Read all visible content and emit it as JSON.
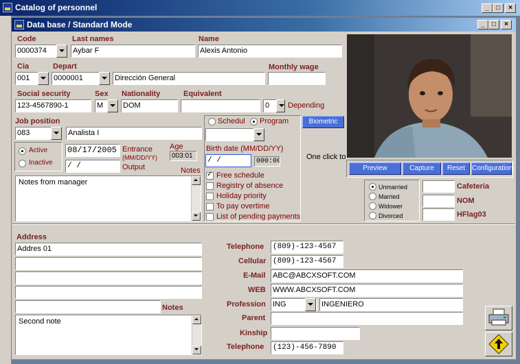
{
  "window": {
    "title": "Catalog of personnel",
    "min": "_",
    "max": "□",
    "close": "×"
  },
  "child": {
    "title": "Data base  /  Standard Mode",
    "min": "_",
    "max": "□",
    "close": "×"
  },
  "labels": {
    "code": "Code",
    "last_names": "Last names",
    "name": "Name",
    "cia": "Cia",
    "depart": "Depart",
    "monthly_wage": "Monthly wage",
    "social_security": "Social  security",
    "sex": "Sex",
    "nationality": "Nationality",
    "equivalent": "Equivalent",
    "depending": "Depending",
    "job_position": "Job position",
    "active": "Active",
    "inactive": "Inactive",
    "entrance": "Entrance",
    "date_format": "(MM/DD/YY)",
    "output": "Output",
    "age": "Age",
    "notes": "Notes",
    "schedul": "Schedul",
    "program": "Program",
    "birth_date": "Birth date (MM/DD/YY)",
    "one_click": "One click to",
    "address": "Address",
    "notes2": "Notes",
    "telephone": "Telephone",
    "cellular": "Cellular",
    "email": "E-Mail",
    "web": "WEB",
    "profession": "Profession",
    "parent": "Parent",
    "kinship": "Kinship",
    "telephone2": "Telephone",
    "cafeteria": "Cafeteria",
    "nom": "NOM",
    "hflag": "HFlag03"
  },
  "values": {
    "code": "0000374",
    "last_names": "Aybar F",
    "name": "Alexis Antonio",
    "cia": "001",
    "depart_code": "0000001",
    "depart_name": "Dirección General",
    "monthly_wage": "",
    "social_security": "123-4567890-1",
    "sex": "M",
    "nationality": "DOM",
    "equivalent": "",
    "depending": "0",
    "job_code": "083",
    "job_name": "Analista I",
    "entrance": "08/17/2005",
    "output": "  /    /",
    "age": "003:01",
    "notes": "Notes from manager",
    "birth_date": " / /",
    "birth_time": "000:00",
    "address1": "Addres 01",
    "address2": "",
    "address3": "",
    "address4": "",
    "address5": "",
    "notes2": "Second note",
    "telephone": "(809)-123-4567",
    "cellular": "(809)-123-4567",
    "email": "ABC@ABCXSOFT.COM",
    "web": "WWW.ABCXSOFT.COM",
    "profession_code": "ING",
    "profession_name": "INGENIERO",
    "parent": "",
    "kinship": "",
    "telephone2": "(123)-456-7890",
    "cafeteria": "",
    "nom": "",
    "hflag": ""
  },
  "checks": [
    {
      "label": "Free schedule",
      "checked": true
    },
    {
      "label": "Registry of absence",
      "checked": false
    },
    {
      "label": "Holiday priority",
      "checked": false
    },
    {
      "label": "To pay overtime",
      "checked": false
    },
    {
      "label": "List of pending payments",
      "checked": false
    }
  ],
  "marital": [
    {
      "label": "Unmarried",
      "selected": true
    },
    {
      "label": "Married",
      "selected": false
    },
    {
      "label": "Widower",
      "selected": false
    },
    {
      "label": "Divorced",
      "selected": false
    }
  ],
  "buttons": {
    "biometric": "Biometric",
    "preview": "Preview",
    "capture": "Capture",
    "reset": "Reset",
    "configuration": "Configuration"
  },
  "status": {
    "active": true,
    "schedul_program": "Program"
  },
  "colors": {
    "label": "#7a1f1f",
    "title": "#0a246a",
    "button": "#4a6fd8"
  },
  "icons": {
    "print": "printer-icon",
    "up": "up-arrow-icon"
  }
}
